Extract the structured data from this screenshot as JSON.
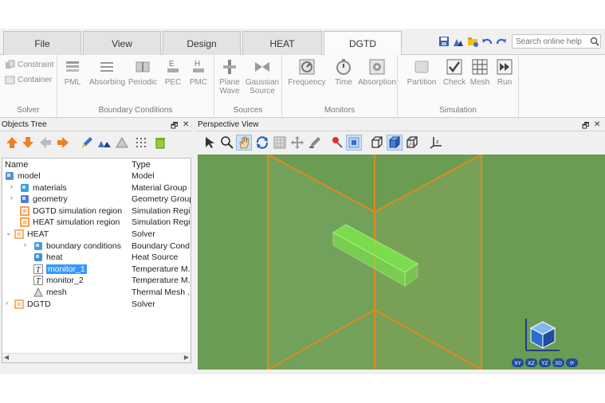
{
  "tabs": [
    {
      "label": "File",
      "active": false
    },
    {
      "label": "View",
      "active": false
    },
    {
      "label": "Design",
      "active": false
    },
    {
      "label": "HEAT",
      "active": false
    },
    {
      "label": "DGTD",
      "active": true
    }
  ],
  "search": {
    "placeholder": "Search online help"
  },
  "ribbon": {
    "solver": {
      "label": "Solver",
      "items": [
        "Constraint",
        "Container"
      ]
    },
    "boundary": {
      "label": "Boundary Conditions",
      "items": [
        "PML",
        "Absorbing",
        "Periodic",
        "PEC",
        "PMC"
      ]
    },
    "sources": {
      "label": "Sources",
      "items": [
        [
          "Plane",
          "Wave"
        ],
        [
          "Gaussian",
          "Source"
        ]
      ]
    },
    "monitors": {
      "label": "Monitors",
      "items": [
        "Frequency",
        "Time",
        "Absorption"
      ]
    },
    "simulation": {
      "label": "Simulation",
      "items": [
        "Partition",
        "Check",
        "Mesh",
        "Run"
      ]
    }
  },
  "objects_tree": {
    "title": "Objects Tree",
    "col_name": "Name",
    "col_type": "Type",
    "rows": [
      {
        "name": "model",
        "type": "Model",
        "indent": 0,
        "expander": "",
        "icon": "model-icon"
      },
      {
        "name": "materials",
        "type": "Material Group",
        "indent": 1,
        "expander": ">",
        "icon": "materials-icon"
      },
      {
        "name": "geometry",
        "type": "Geometry Group",
        "indent": 1,
        "expander": ">",
        "icon": "geometry-icon"
      },
      {
        "name": "DGTD simulation region",
        "type": "Simulation Regi...",
        "indent": 1,
        "expander": "",
        "icon": "region-icon"
      },
      {
        "name": "HEAT simulation region",
        "type": "Simulation Regi...",
        "indent": 1,
        "expander": "",
        "icon": "region-icon"
      },
      {
        "name": "HEAT",
        "type": "Solver",
        "indent": 0,
        "expander": "v",
        "icon": "solver-icon"
      },
      {
        "name": "boundary conditions",
        "type": "Boundary Cond...",
        "indent": 2,
        "expander": ">",
        "icon": "boundary-icon"
      },
      {
        "name": "heat",
        "type": "Heat Source",
        "indent": 2,
        "expander": "",
        "icon": "heat-source-icon"
      },
      {
        "name": "monitor_1",
        "type": "Temperature M...",
        "indent": 2,
        "expander": "",
        "icon": "temperature-monitor-icon",
        "selected": true
      },
      {
        "name": "monitor_2",
        "type": "Temperature M...",
        "indent": 2,
        "expander": "",
        "icon": "temperature-monitor-icon"
      },
      {
        "name": "mesh",
        "type": "Thermal Mesh ...",
        "indent": 2,
        "expander": "",
        "icon": "mesh-icon"
      },
      {
        "name": "DGTD",
        "type": "Solver",
        "indent": 0,
        "expander": ">",
        "icon": "solver-icon"
      }
    ]
  },
  "perspective_view": {
    "title": "Perspective View",
    "background": "#6b9c54",
    "edge_color": "#e08a1e",
    "object_color": "#7cf04a"
  },
  "window_controls": {
    "float": "🗗",
    "close": "✕"
  },
  "axis_buttons": [
    "XY",
    "XZ",
    "YZ",
    "3D",
    "⟳"
  ]
}
